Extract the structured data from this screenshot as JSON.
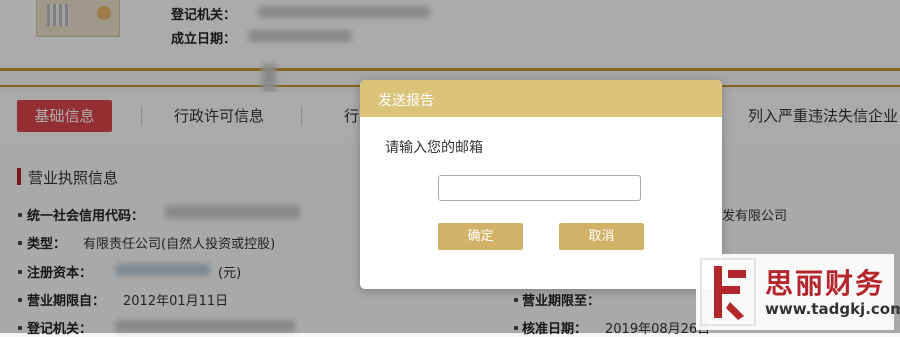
{
  "header": {
    "labels": {
      "registration_authority": "登记机关：",
      "established_date": "成立日期："
    },
    "license_thumbnail": "business-license-thumbnail"
  },
  "tabs": [
    {
      "label": "基础信息",
      "active": true
    },
    {
      "label": "行政许可信息"
    },
    {
      "label": "行"
    },
    {
      "label": "列入严重违法失信企业"
    }
  ],
  "section": {
    "title": "营业执照信息"
  },
  "fields": {
    "credit_code": {
      "label": "统一社会信用代码："
    },
    "type": {
      "label": "类型：",
      "value": "有限责任公司(自然人投资或控股)"
    },
    "registered_capital": {
      "label": "注册资本：",
      "value": "(元)"
    },
    "term_from": {
      "label": "营业期限自：",
      "value": "2012年01月11日"
    },
    "registration_authority": {
      "label": "登记机关："
    },
    "name_suffix": {
      "value": "发有限公司"
    },
    "term_to": {
      "label": "营业期限至："
    },
    "approval_date": {
      "label": "核准日期：",
      "value": "2019年08月26日"
    }
  },
  "dialog": {
    "title": "发送报告",
    "prompt": "请输入您的邮箱",
    "email_value": "",
    "confirm_label": "确定",
    "cancel_label": "取消"
  },
  "watermark": {
    "logo_icon": "sili-finance-logo",
    "name": "思丽财务",
    "url": "www.tadgkj.com"
  },
  "colors": {
    "gold_line": "#c3962e",
    "active_tab": "#d9454a",
    "dialog_header": "#dcc37a",
    "dialog_button": "#d2b266",
    "section_marker": "#b3262c"
  }
}
